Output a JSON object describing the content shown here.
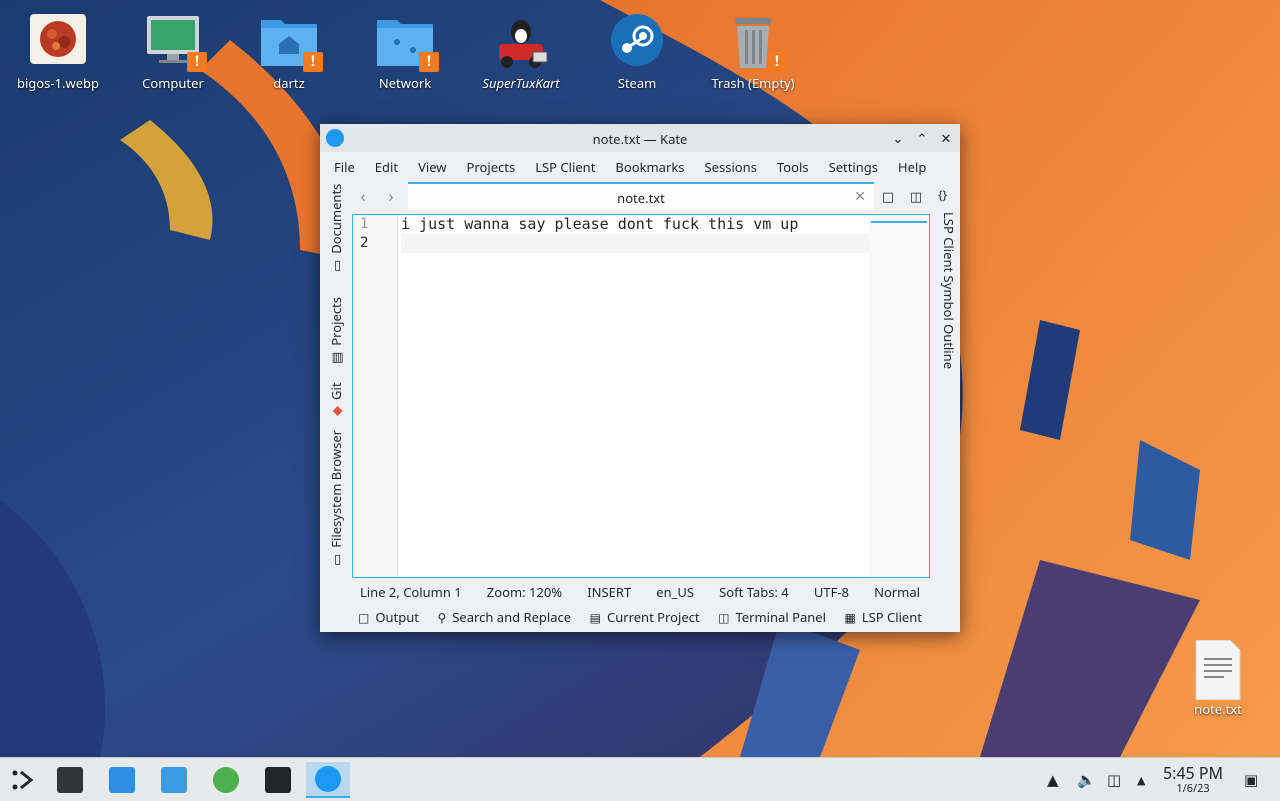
{
  "desktop": {
    "icons": [
      {
        "label": "bigos-1.webp"
      },
      {
        "label": "Computer"
      },
      {
        "label": "dartz"
      },
      {
        "label": "Network"
      },
      {
        "label": "SuperTuxKart"
      },
      {
        "label": "Steam"
      },
      {
        "label": "Trash (Empty)"
      },
      {
        "label": "note.txt"
      }
    ]
  },
  "window": {
    "title": "note.txt — Kate",
    "menu": [
      "File",
      "Edit",
      "View",
      "Projects",
      "LSP Client",
      "Bookmarks",
      "Sessions",
      "Tools",
      "Settings",
      "Help"
    ],
    "left_panels": [
      "Documents",
      "Projects",
      "Git",
      "Filesystem Browser"
    ],
    "right_panel": "LSP Client Symbol Outline",
    "tab": {
      "name": "note.txt"
    },
    "editor": {
      "lines": [
        "i just wanna say please dont fuck this vm up",
        ""
      ],
      "line_numbers": [
        "1",
        "2"
      ]
    },
    "status": {
      "position": "Line 2, Column 1",
      "zoom": "Zoom: 120%",
      "mode": "INSERT",
      "language": "en_US",
      "indent": "Soft Tabs: 4",
      "encoding": "UTF-8",
      "highlight": "Normal"
    },
    "bottom_panels": [
      "Output",
      "Search and Replace",
      "Current Project",
      "Terminal Panel",
      "LSP Client"
    ]
  },
  "taskbar": {
    "time": "5:45 PM",
    "date": "1/6/23"
  },
  "colors": {
    "accent": "#3daee9",
    "warning": "#f47a20"
  }
}
